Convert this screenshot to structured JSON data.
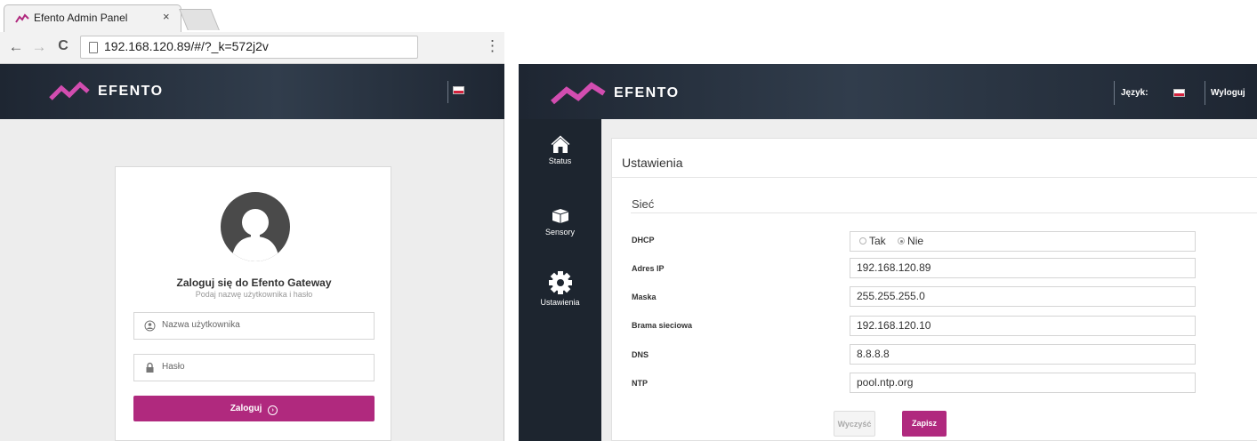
{
  "browser": {
    "tab_title": "Efento Admin Panel",
    "tab_close": "×",
    "url": "192.168.120.89/#/?_k=572j2v",
    "back_glyph": "←",
    "forward_glyph": "→",
    "reload_glyph": "C",
    "menu_glyph": "⋮"
  },
  "brand": {
    "name": "EFENTO",
    "logo_colors": [
      "#b0297e",
      "#d24db0"
    ]
  },
  "login": {
    "title": "Zaloguj się do Efento Gateway",
    "subtitle": "Podaj nazwę użytkownika i hasło",
    "username_placeholder": "Nazwa użytkownika",
    "password_placeholder": "Hasło",
    "button_label": "Zaloguj",
    "button_icon": "arrow-circle-right-icon",
    "button_arrow_glyph": "›"
  },
  "admin": {
    "language_label": "Język:",
    "logout_label": "Wyloguj",
    "sidebar": [
      {
        "label": "Status",
        "icon": "home-icon"
      },
      {
        "label": "Sensory",
        "icon": "sensor-icon"
      },
      {
        "label": "Ustawienia",
        "icon": "gear-icon"
      }
    ],
    "page_title": "Ustawienia",
    "section_title": "Sieć",
    "fields": {
      "dhcp": {
        "label": "DHCP",
        "options": [
          "Tak",
          "Nie"
        ],
        "selected": "Nie"
      },
      "ip": {
        "label": "Adres IP",
        "value": "192.168.120.89"
      },
      "mask": {
        "label": "Maska",
        "value": "255.255.255.0"
      },
      "gateway": {
        "label": "Brama sieciowa",
        "value": "192.168.120.10"
      },
      "dns": {
        "label": "DNS",
        "value": "8.8.8.8"
      },
      "ntp": {
        "label": "NTP",
        "value": "pool.ntp.org"
      }
    },
    "clear_button": "Wyczyść",
    "save_button": "Zapisz"
  },
  "colors": {
    "accent": "#b0297e",
    "header_dark": "#1e2632",
    "sidebar": "#1d252f",
    "flag_white": "#ffffff",
    "flag_red": "#d4213d"
  }
}
